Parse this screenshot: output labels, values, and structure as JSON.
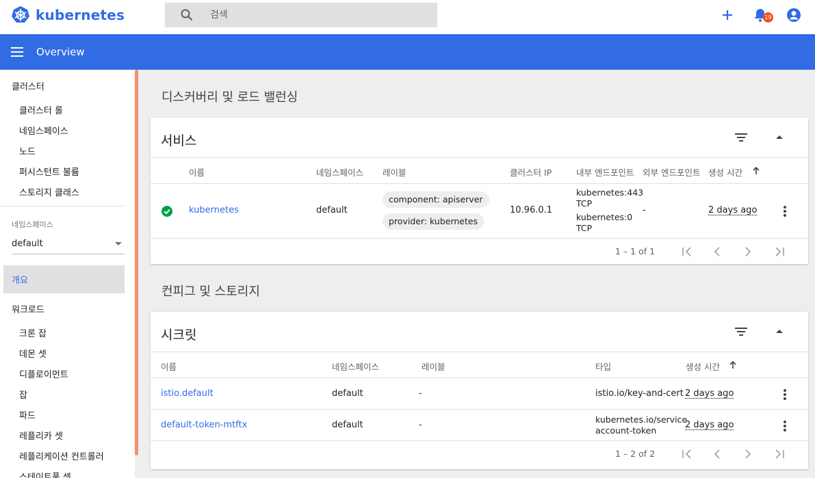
{
  "top": {
    "brand": "kubernetes",
    "search_placeholder": "검색",
    "notification_count": "19"
  },
  "appbar": {
    "title": "Overview"
  },
  "sidebar": {
    "cluster_head": "클러스터",
    "cluster_items": [
      "클러스터 롤",
      "네임스페이스",
      "노드",
      "퍼시스턴트 볼륨",
      "스토리지 클래스"
    ],
    "namespace_label": "네임스페이스",
    "namespace_value": "default",
    "overview": "개요",
    "workload_head": "워크로드",
    "workload_items": [
      "크론 잡",
      "데몬 셋",
      "디플로이먼트",
      "잡",
      "파드",
      "레플리카 셋",
      "레플리케이션 컨트롤러",
      "스테이트풀 셋"
    ]
  },
  "discovery": {
    "section_title": "디스커버리 및 로드 밸런싱",
    "card_title": "서비스",
    "headers": [
      "이름",
      "네임스페이스",
      "레이블",
      "클러스터 IP",
      "내부 엔드포인트",
      "외부 엔드포인트",
      "생성 시간"
    ],
    "row": {
      "name": "kubernetes",
      "namespace": "default",
      "labels": [
        "component: apiserver",
        "provider: kubernetes"
      ],
      "cluster_ip": "10.96.0.1",
      "internal_endpoints": [
        "kubernetes:443",
        "TCP",
        "kubernetes:0",
        "TCP"
      ],
      "external_endpoint": "-",
      "age": "2 days ago"
    },
    "pagination": "1 – 1 of 1"
  },
  "config": {
    "section_title": "컨피그 및 스토리지",
    "card_title": "시크릿",
    "headers": [
      "이름",
      "네임스페이스",
      "레이블",
      "타입",
      "생성 시간"
    ],
    "rows": [
      {
        "name": "istio.default",
        "namespace": "default",
        "labels": "-",
        "type": [
          "istio.io/key-and-cert"
        ],
        "age": "2 days ago"
      },
      {
        "name": "default-token-mtftx",
        "namespace": "default",
        "labels": "-",
        "type": [
          "kubernetes.io/service",
          "account-token"
        ],
        "age": "2 days ago"
      }
    ],
    "pagination": "1 – 2 of 2"
  },
  "colors": {
    "primary": "#326ce5",
    "success": "#00a046",
    "badge": "#f4511e",
    "scroll": "#f4916b"
  }
}
